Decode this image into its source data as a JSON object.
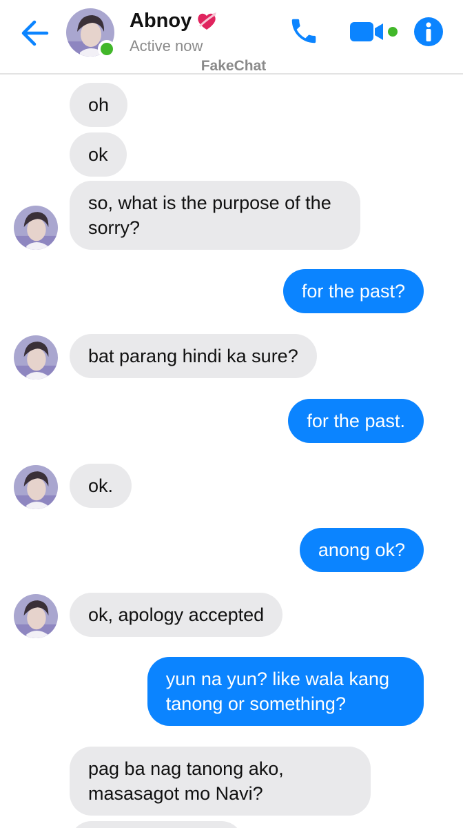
{
  "header": {
    "contact_name": "Abnoy",
    "status": "Active now",
    "watermark": "FakeChat",
    "name_emoji": "heart-with-ribbon-icon"
  },
  "colors": {
    "accent": "#0b84ff",
    "incoming_bubble": "#e9e9eb",
    "online": "#42b72a"
  },
  "messages": [
    {
      "side": "in",
      "text": "oh",
      "avatar": false
    },
    {
      "side": "in",
      "text": "ok",
      "avatar": false
    },
    {
      "side": "in",
      "text": "so, what is the purpose of the\nsorry?",
      "avatar": true
    },
    {
      "side": "out",
      "text": "for the past?"
    },
    {
      "side": "in",
      "text": "bat parang hindi ka sure?",
      "avatar": true
    },
    {
      "side": "out",
      "text": "for the past."
    },
    {
      "side": "in",
      "text": "ok.",
      "avatar": true
    },
    {
      "side": "out",
      "text": "anong ok?"
    },
    {
      "side": "in",
      "text": "ok, apology accepted",
      "avatar": true
    },
    {
      "side": "out",
      "text": "yun na yun? like wala kang\ntanong or something?"
    },
    {
      "side": "in",
      "text": "pag ba nag tanong ako,\nmasasagot mo Navi?",
      "avatar": false
    }
  ]
}
